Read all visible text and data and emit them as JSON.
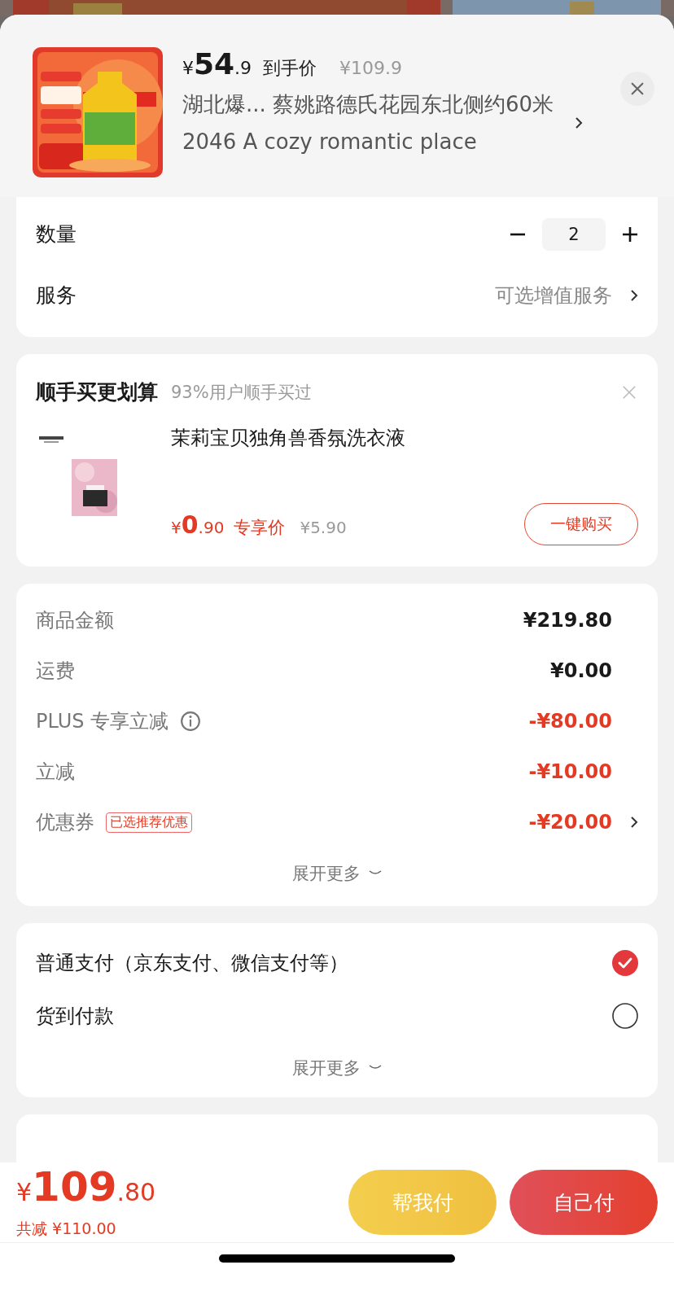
{
  "product": {
    "price_symbol": "¥",
    "price_int": "54",
    "price_dec": ".9",
    "price_label": "到手价",
    "original_price": "¥109.9",
    "address": "湖北爆...  蔡姚路德氏花园东北侧约60米 2046 A cozy romantic place"
  },
  "quantity": {
    "label": "数量",
    "value": "2"
  },
  "service": {
    "label": "服务",
    "value": "可选增值服务"
  },
  "addon": {
    "title": "顺手买更划算",
    "subtitle": "93%用户顺手买过",
    "item": {
      "name": "茉莉宝贝独角兽香氛洗衣液",
      "price_symbol": "¥",
      "price_int": "0",
      "price_dec": ".90",
      "price_label": "专享价",
      "original_price": "¥5.90",
      "button": "一键购买"
    }
  },
  "summary": {
    "rows": [
      {
        "label": "商品金额",
        "value": "¥219.80",
        "kind": "plain",
        "info": false,
        "chevron": false
      },
      {
        "label": "运费",
        "value": "¥0.00",
        "kind": "plain",
        "info": false,
        "chevron": false
      },
      {
        "label": "PLUS 专享立减",
        "value": "-¥80.00",
        "kind": "discount",
        "info": true,
        "chevron": false
      },
      {
        "label": "立减",
        "value": "-¥10.00",
        "kind": "discount",
        "info": false,
        "chevron": false
      },
      {
        "label": "优惠券",
        "tag": "已选推荐优惠",
        "value": "-¥20.00",
        "kind": "discount",
        "info": false,
        "chevron": true
      }
    ],
    "expand": "展开更多"
  },
  "payment": {
    "options": [
      {
        "label": "普通支付（京东支付、微信支付等）",
        "selected": true
      },
      {
        "label": "货到付款",
        "selected": false
      }
    ],
    "expand": "展开更多"
  },
  "footer": {
    "price_symbol": "¥",
    "price_int": "109",
    "price_dec": ".80",
    "saved": "共减 ¥110.00",
    "buttons": [
      {
        "label": "帮我付",
        "kind": "secondary"
      },
      {
        "label": "自己付",
        "kind": "primary"
      }
    ]
  }
}
